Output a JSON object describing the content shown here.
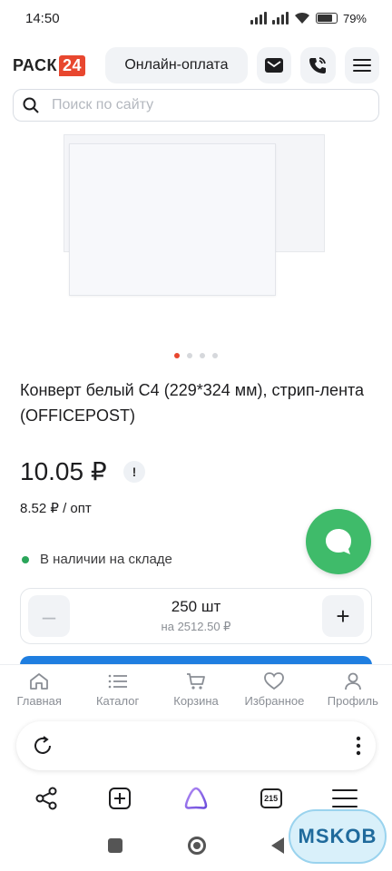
{
  "status_bar": {
    "time": "14:50",
    "battery": "79%"
  },
  "header": {
    "logo_text": "РАСК",
    "logo_badge": "24",
    "pay_button": "Онлайн-оплата",
    "icons": [
      "mail-icon",
      "phone-icon",
      "menu-icon"
    ]
  },
  "search": {
    "placeholder": "Поиск по сайту"
  },
  "carousel": {
    "count": 4,
    "active": 0
  },
  "product": {
    "title": "Конверт белый С4 (229*324 мм), стрип-лента (OFFICEPOST)",
    "price": "10.05 ₽",
    "opt_price": "8.52 ₽ / опт",
    "stock": "В наличии на складе",
    "quantity": "250 шт",
    "quantity_total": "на 2512.50 ₽"
  },
  "bottom_nav": [
    {
      "label": "Главная",
      "icon": "home-icon"
    },
    {
      "label": "Каталог",
      "icon": "catalog-icon"
    },
    {
      "label": "Корзина",
      "icon": "cart-icon"
    },
    {
      "label": "Избранное",
      "icon": "heart-icon"
    },
    {
      "label": "Профиль",
      "icon": "profile-icon"
    }
  ],
  "browser": {
    "tab_count": "215"
  },
  "watermark": "MSKOB",
  "colors": {
    "accent": "#e8472f",
    "chat": "#3fbb6a",
    "stock": "#2aa55a",
    "buy": "#1f7ee0"
  }
}
